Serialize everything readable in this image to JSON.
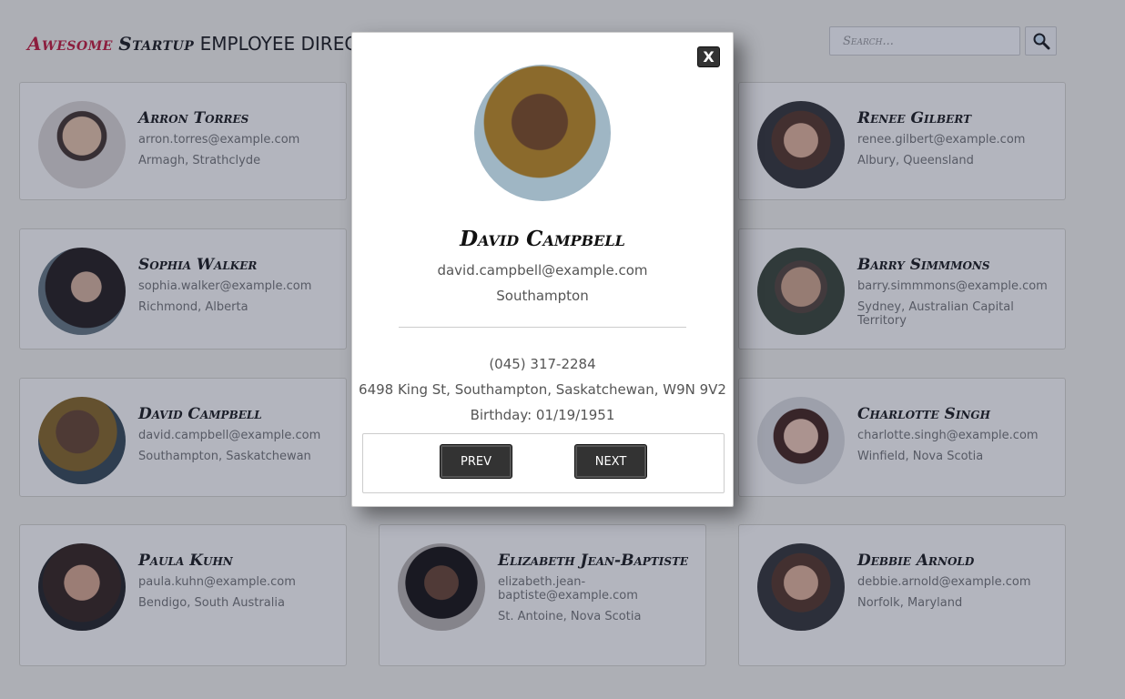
{
  "header": {
    "title_word1": "Awesome",
    "title_word2": "Startup",
    "title_word3": "EMPLOYEE DIRECTORY"
  },
  "search": {
    "placeholder": "Search..."
  },
  "employees": [
    {
      "name": "Arron Torres",
      "email": "arron.torres@example.com",
      "location": "Armagh, Strathclyde"
    },
    {
      "name": "Renee Gilbert",
      "email": "renee.gilbert@example.com",
      "location": "Albury, Queensland"
    },
    {
      "name": "Sophia Walker",
      "email": "sophia.walker@example.com",
      "location": "Richmond, Alberta"
    },
    {
      "name": "Barry Simmmons",
      "email": "barry.simmmons@example.com",
      "location": "Sydney, Australian Capital Territory"
    },
    {
      "name": "David Campbell",
      "email": "david.campbell@example.com",
      "location": "Southampton, Saskatchewan"
    },
    {
      "name": "Charlotte Singh",
      "email": "charlotte.singh@example.com",
      "location": "Winfield, Nova Scotia"
    },
    {
      "name": "Paula Kuhn",
      "email": "paula.kuhn@example.com",
      "location": "Bendigo, South Australia"
    },
    {
      "name": "Elizabeth Jean-Baptiste",
      "email": "elizabeth.jean-baptiste@example.com",
      "location": "St. Antoine, Nova Scotia"
    },
    {
      "name": "Debbie Arnold",
      "email": "debbie.arnold@example.com",
      "location": "Norfolk, Maryland"
    }
  ],
  "modal": {
    "close_label": "X",
    "name": "David Campbell",
    "email": "david.campbell@example.com",
    "city": "Southampton",
    "phone": "(045) 317-2284",
    "address": "6498 King St, Southampton, Saskatchewan, W9N 9V2",
    "birthday": "Birthday: 01/19/1951",
    "prev_label": "PREV",
    "next_label": "NEXT"
  }
}
